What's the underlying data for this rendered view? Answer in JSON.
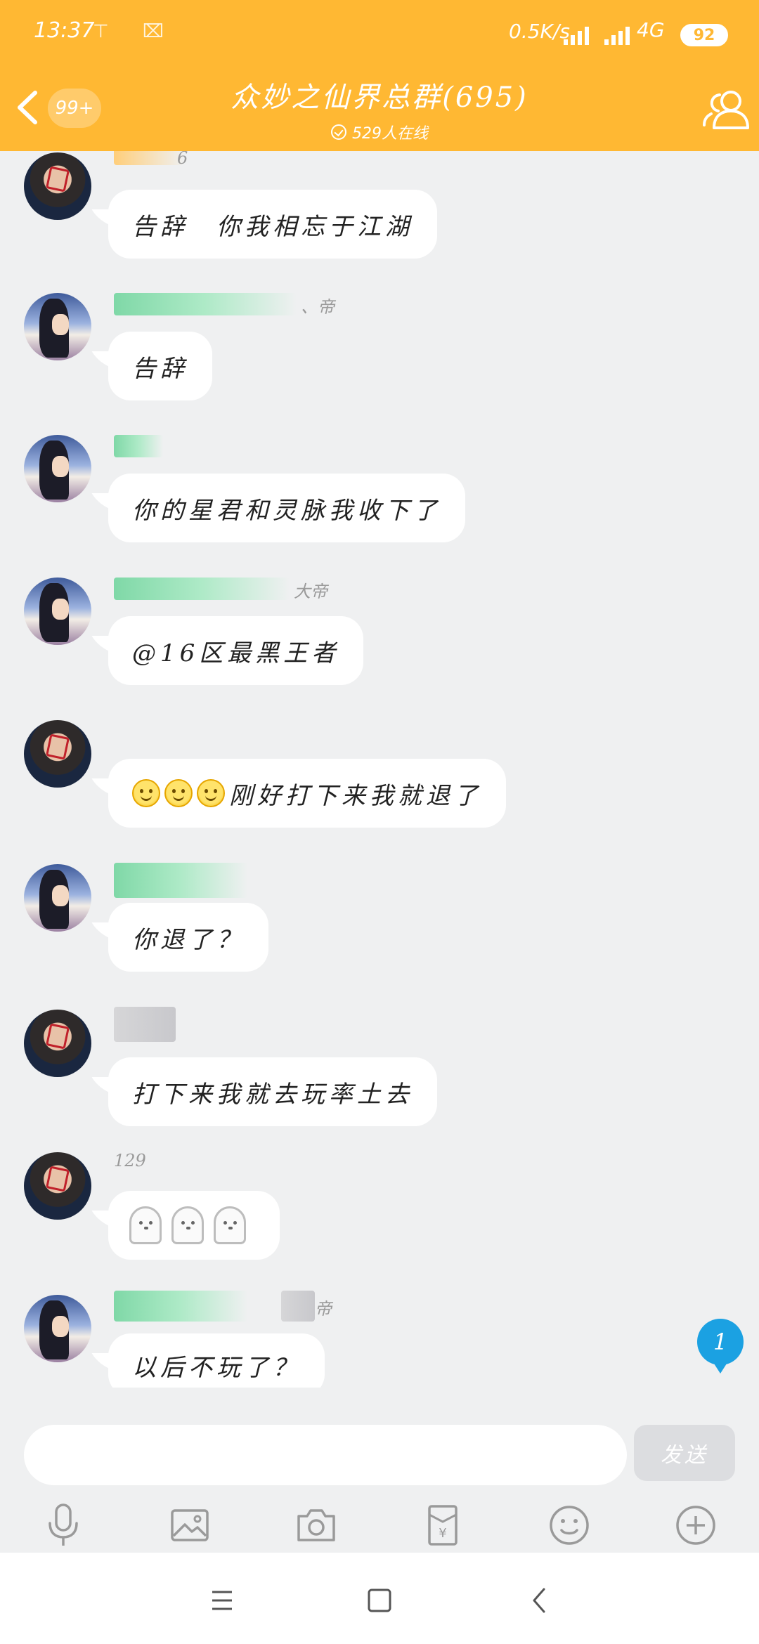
{
  "status_bar": {
    "time": "13:37",
    "notif_icons": "⊤ ⌧",
    "speed": "0.5K/s",
    "network": "4G",
    "battery": "92"
  },
  "header": {
    "unread_count": "99+",
    "title": "众妙之仙界总群(695)",
    "online_text": "529人在线"
  },
  "messages": [
    {
      "nickname_tail": "6",
      "text": "告辞　你我相忘于江湖"
    },
    {
      "nickname_tail": "、帝",
      "text": "告辞"
    },
    {
      "nickname_tail": "",
      "text": "你的星君和灵脉我收下了"
    },
    {
      "nickname_tail": "大帝",
      "text": "@16区最黑王者"
    },
    {
      "nickname_tail": "",
      "text": "刚好打下来我就退了"
    },
    {
      "nickname_tail": "",
      "text": "你退了？"
    },
    {
      "nickname_tail": "",
      "text": "打下来我就去玩率土去"
    },
    {
      "nickname_tail": "129",
      "text": ""
    },
    {
      "nickname_tail": "帝",
      "text": "以后不玩了？"
    }
  ],
  "unread_indicator": "1",
  "input": {
    "placeholder": "",
    "send_label": "发送"
  },
  "toolbar_icons": [
    "microphone-icon",
    "image-icon",
    "camera-icon",
    "red-packet-icon",
    "emoji-icon",
    "plus-icon"
  ],
  "colors": {
    "header": "#ffb833",
    "background": "#eff0f1",
    "unread_indicator": "#1ba1e2"
  }
}
